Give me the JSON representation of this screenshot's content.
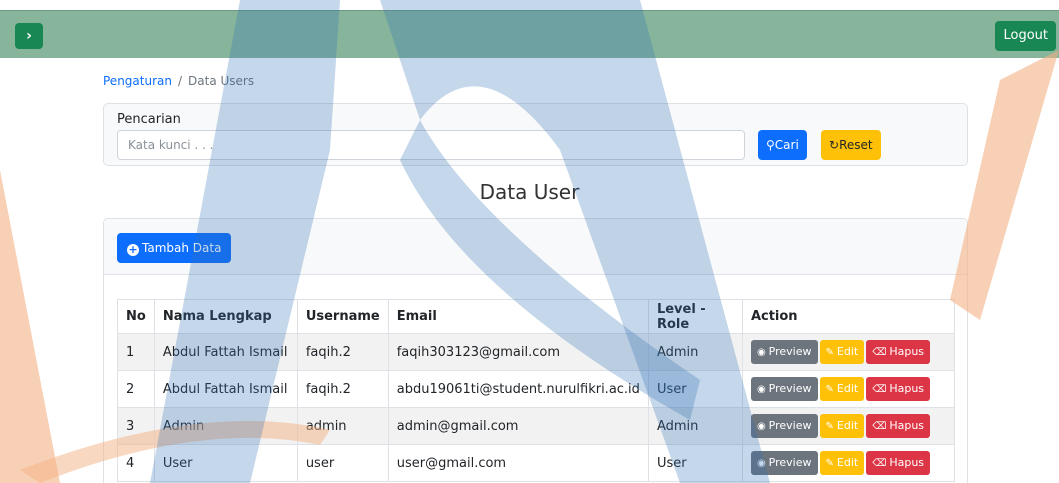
{
  "topbar": {
    "toggle_icon": "chevron-right-icon",
    "logout_label": "Logout"
  },
  "breadcrumb": {
    "parent": "Pengaturan",
    "separator": "/",
    "current": "Data Users"
  },
  "search": {
    "label": "Pencarian",
    "placeholder": "Kata kunci . . .",
    "value": "",
    "search_button": "Cari",
    "reset_button": "Reset"
  },
  "page_title": "Data User",
  "add_button": "Tambah Data",
  "table": {
    "headers": [
      "No",
      "Nama Lengkap",
      "Username",
      "Email",
      "Level - Role",
      "Action"
    ],
    "rows": [
      {
        "no": "1",
        "name": "Abdul Fattah Ismail",
        "username": "faqih.2",
        "email": "faqih303123@gmail.com",
        "level": "Admin"
      },
      {
        "no": "2",
        "name": "Abdul Fattah Ismail",
        "username": "faqih.2",
        "email": "abdu19061ti@student.nurulfikri.ac.id",
        "level": "User"
      },
      {
        "no": "3",
        "name": "Admin",
        "username": "admin",
        "email": "admin@gmail.com",
        "level": "Admin"
      },
      {
        "no": "4",
        "name": "User",
        "username": "user",
        "email": "user@gmail.com",
        "level": "User"
      }
    ],
    "actions": {
      "preview": "Preview",
      "edit": "Edit",
      "delete": "Hapus"
    }
  },
  "colors": {
    "topbar": "#87b59c",
    "primary": "#0d6efd",
    "success": "#198754",
    "warning": "#ffc107",
    "danger": "#dc3545",
    "secondary": "#6c757d"
  }
}
